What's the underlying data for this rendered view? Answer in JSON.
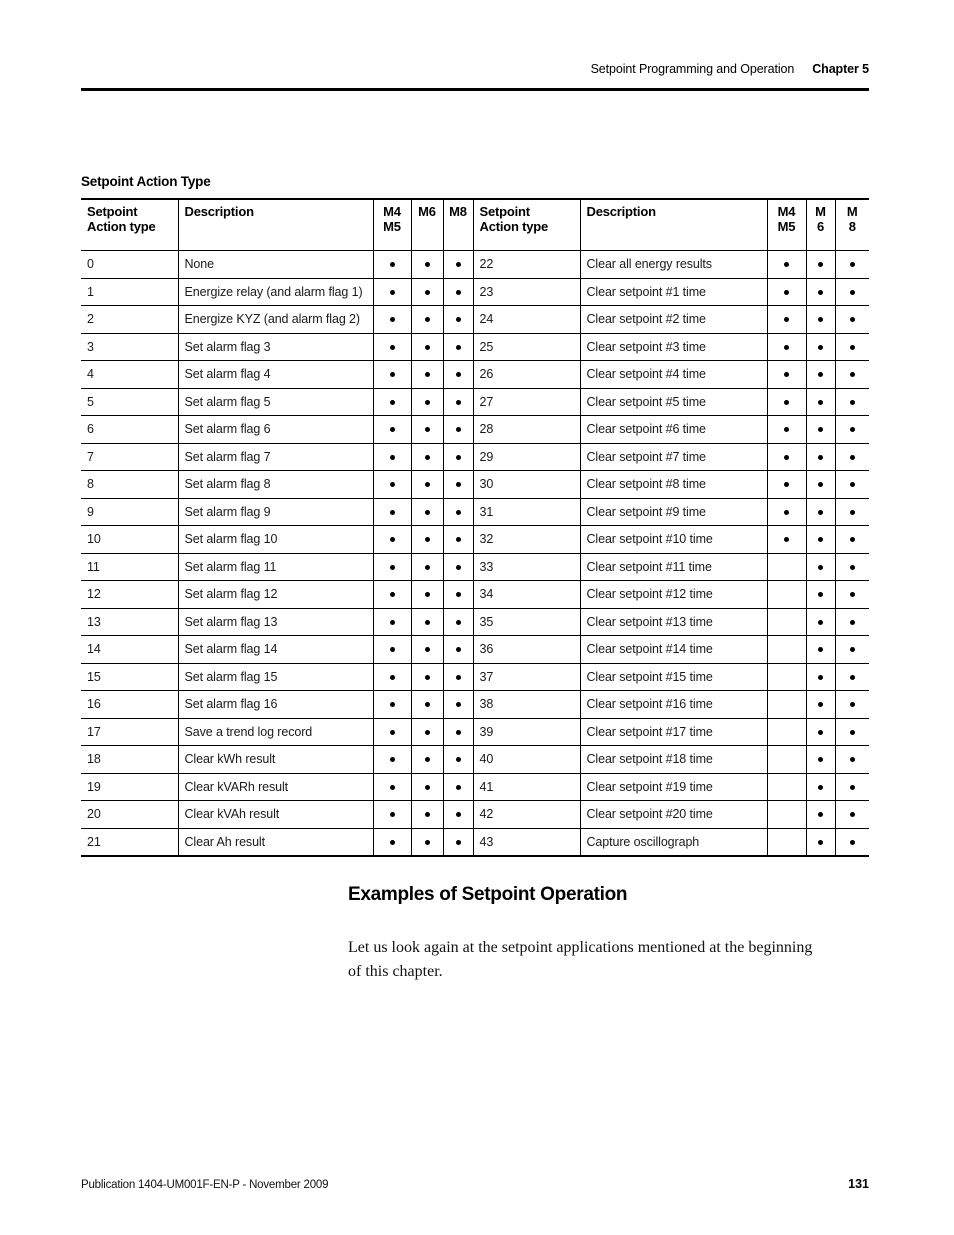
{
  "running_head": {
    "title": "Setpoint Programming and Operation",
    "chapter": "Chapter 5"
  },
  "table_caption": "Setpoint Action Type",
  "table": {
    "headers_left": {
      "action_type": "Setpoint\nAction type",
      "description": "Description",
      "m45": "M4\nM5",
      "m6": "M6",
      "m8": "M8"
    },
    "headers_right": {
      "action_type": "Setpoint\nAction type",
      "description": "Description",
      "m45": "M4\nM5",
      "m6": "M\n6",
      "m8": "M\n8"
    },
    "rows": [
      {
        "l_num": "0",
        "l_desc": "None",
        "l_m45": true,
        "l_m6": true,
        "l_m8": true,
        "r_num": "22",
        "r_desc": "Clear all energy results",
        "r_m45": true,
        "r_m6": true,
        "r_m8": true
      },
      {
        "l_num": "1",
        "l_desc": "Energize relay (and alarm flag 1)",
        "l_m45": true,
        "l_m6": true,
        "l_m8": true,
        "r_num": "23",
        "r_desc": "Clear setpoint #1 time",
        "r_m45": true,
        "r_m6": true,
        "r_m8": true
      },
      {
        "l_num": "2",
        "l_desc": "Energize KYZ (and alarm flag 2)",
        "l_m45": true,
        "l_m6": true,
        "l_m8": true,
        "r_num": "24",
        "r_desc": "Clear setpoint #2 time",
        "r_m45": true,
        "r_m6": true,
        "r_m8": true
      },
      {
        "l_num": "3",
        "l_desc": "Set alarm flag 3",
        "l_m45": true,
        "l_m6": true,
        "l_m8": true,
        "r_num": "25",
        "r_desc": "Clear setpoint #3 time",
        "r_m45": true,
        "r_m6": true,
        "r_m8": true
      },
      {
        "l_num": "4",
        "l_desc": "Set alarm flag 4",
        "l_m45": true,
        "l_m6": true,
        "l_m8": true,
        "r_num": "26",
        "r_desc": "Clear setpoint #4 time",
        "r_m45": true,
        "r_m6": true,
        "r_m8": true
      },
      {
        "l_num": "5",
        "l_desc": "Set alarm flag 5",
        "l_m45": true,
        "l_m6": true,
        "l_m8": true,
        "r_num": "27",
        "r_desc": "Clear setpoint #5 time",
        "r_m45": true,
        "r_m6": true,
        "r_m8": true
      },
      {
        "l_num": "6",
        "l_desc": "Set alarm flag 6",
        "l_m45": true,
        "l_m6": true,
        "l_m8": true,
        "r_num": "28",
        "r_desc": "Clear setpoint #6 time",
        "r_m45": true,
        "r_m6": true,
        "r_m8": true
      },
      {
        "l_num": "7",
        "l_desc": "Set alarm flag 7",
        "l_m45": true,
        "l_m6": true,
        "l_m8": true,
        "r_num": "29",
        "r_desc": "Clear setpoint #7 time",
        "r_m45": true,
        "r_m6": true,
        "r_m8": true
      },
      {
        "l_num": "8",
        "l_desc": "Set alarm flag 8",
        "l_m45": true,
        "l_m6": true,
        "l_m8": true,
        "r_num": "30",
        "r_desc": "Clear setpoint #8 time",
        "r_m45": true,
        "r_m6": true,
        "r_m8": true
      },
      {
        "l_num": "9",
        "l_desc": "Set alarm flag 9",
        "l_m45": true,
        "l_m6": true,
        "l_m8": true,
        "r_num": "31",
        "r_desc": "Clear setpoint #9 time",
        "r_m45": true,
        "r_m6": true,
        "r_m8": true
      },
      {
        "l_num": "10",
        "l_desc": "Set alarm flag 10",
        "l_m45": true,
        "l_m6": true,
        "l_m8": true,
        "r_num": "32",
        "r_desc": "Clear setpoint #10 time",
        "r_m45": true,
        "r_m6": true,
        "r_m8": true
      },
      {
        "l_num": "11",
        "l_desc": "Set alarm flag 11",
        "l_m45": true,
        "l_m6": true,
        "l_m8": true,
        "r_num": "33",
        "r_desc": "Clear setpoint #11 time",
        "r_m45": false,
        "r_m6": true,
        "r_m8": true
      },
      {
        "l_num": "12",
        "l_desc": "Set alarm flag 12",
        "l_m45": true,
        "l_m6": true,
        "l_m8": true,
        "r_num": "34",
        "r_desc": "Clear setpoint #12 time",
        "r_m45": false,
        "r_m6": true,
        "r_m8": true
      },
      {
        "l_num": "13",
        "l_desc": "Set alarm flag 13",
        "l_m45": true,
        "l_m6": true,
        "l_m8": true,
        "r_num": "35",
        "r_desc": "Clear setpoint #13 time",
        "r_m45": false,
        "r_m6": true,
        "r_m8": true
      },
      {
        "l_num": "14",
        "l_desc": "Set alarm flag 14",
        "l_m45": true,
        "l_m6": true,
        "l_m8": true,
        "r_num": "36",
        "r_desc": "Clear setpoint #14 time",
        "r_m45": false,
        "r_m6": true,
        "r_m8": true
      },
      {
        "l_num": "15",
        "l_desc": "Set alarm flag 15",
        "l_m45": true,
        "l_m6": true,
        "l_m8": true,
        "r_num": "37",
        "r_desc": "Clear setpoint #15 time",
        "r_m45": false,
        "r_m6": true,
        "r_m8": true
      },
      {
        "l_num": "16",
        "l_desc": "Set alarm flag 16",
        "l_m45": true,
        "l_m6": true,
        "l_m8": true,
        "r_num": "38",
        "r_desc": "Clear setpoint #16 time",
        "r_m45": false,
        "r_m6": true,
        "r_m8": true
      },
      {
        "l_num": "17",
        "l_desc": "Save a trend log record",
        "l_m45": true,
        "l_m6": true,
        "l_m8": true,
        "r_num": "39",
        "r_desc": "Clear setpoint #17 time",
        "r_m45": false,
        "r_m6": true,
        "r_m8": true
      },
      {
        "l_num": "18",
        "l_desc": "Clear kWh result",
        "l_m45": true,
        "l_m6": true,
        "l_m8": true,
        "r_num": "40",
        "r_desc": "Clear setpoint #18 time",
        "r_m45": false,
        "r_m6": true,
        "r_m8": true
      },
      {
        "l_num": "19",
        "l_desc": "Clear kVARh result",
        "l_m45": true,
        "l_m6": true,
        "l_m8": true,
        "r_num": "41",
        "r_desc": "Clear setpoint #19 time",
        "r_m45": false,
        "r_m6": true,
        "r_m8": true
      },
      {
        "l_num": "20",
        "l_desc": "Clear kVAh result",
        "l_m45": true,
        "l_m6": true,
        "l_m8": true,
        "r_num": "42",
        "r_desc": "Clear setpoint #20 time",
        "r_m45": false,
        "r_m6": true,
        "r_m8": true
      },
      {
        "l_num": "21",
        "l_desc": "Clear Ah result",
        "l_m45": true,
        "l_m6": true,
        "l_m8": true,
        "r_num": "43",
        "r_desc": "Capture oscillograph",
        "r_m45": false,
        "r_m6": true,
        "r_m8": true
      }
    ]
  },
  "section": {
    "heading": "Examples of Setpoint Operation",
    "body": "Let us look again at the setpoint applications mentioned at the beginning of this chapter."
  },
  "footer": {
    "publication": "Publication 1404-UM001F-EN-P - November 2009",
    "page_number": "131"
  }
}
